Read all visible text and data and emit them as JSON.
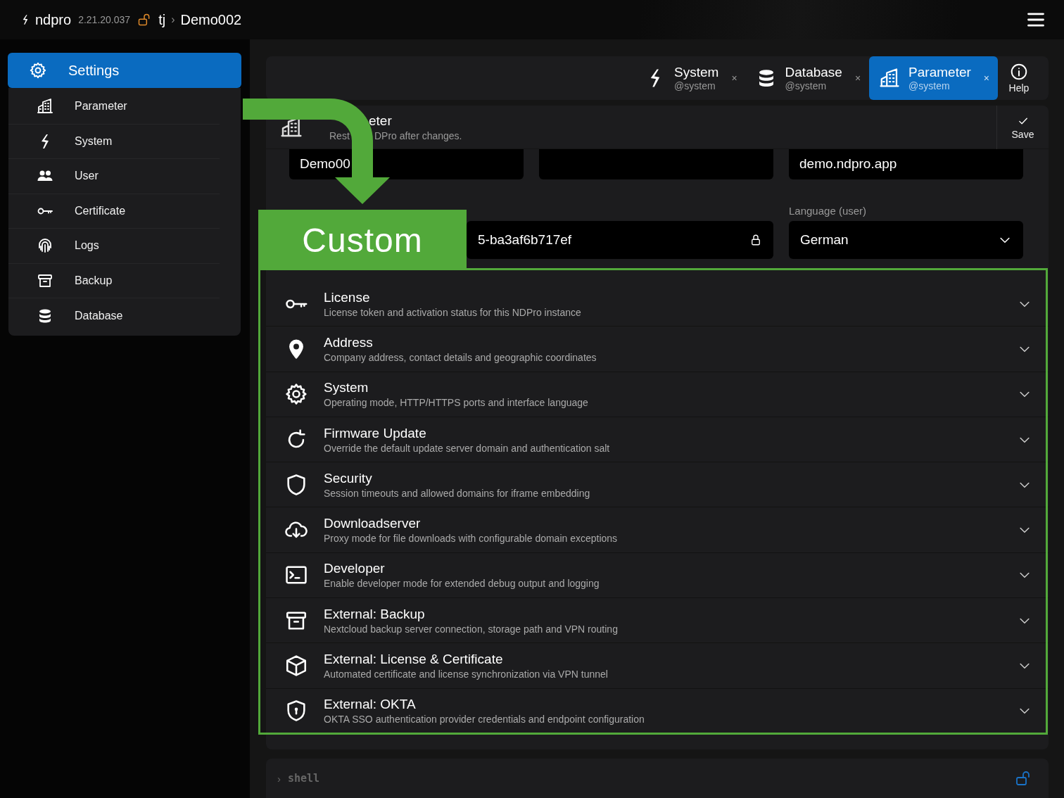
{
  "topbar": {
    "brand": "ndpro",
    "version": "2.21.20.037",
    "user": "tj",
    "separator": "›",
    "instance": "Demo002"
  },
  "sidebar": {
    "header": "Settings",
    "items": [
      {
        "label": "Parameter"
      },
      {
        "label": "System"
      },
      {
        "label": "User"
      },
      {
        "label": "Certificate"
      },
      {
        "label": "Logs"
      },
      {
        "label": "Backup"
      },
      {
        "label": "Database"
      }
    ]
  },
  "tabs": [
    {
      "label": "System",
      "subtitle": "@system",
      "close": "×",
      "selected": false
    },
    {
      "label": "Database",
      "subtitle": "@system",
      "close": "×",
      "selected": false
    },
    {
      "label": "Parameter",
      "subtitle": "@system",
      "close": "×",
      "selected": true
    }
  ],
  "help": "Help",
  "panel": {
    "title": "eter",
    "subtitle_parts": [
      "Rest",
      "DPro after changes."
    ],
    "save": "Save",
    "fields_row_1": [
      {
        "kind": "text",
        "value": "Demo00"
      },
      {
        "kind": "blank"
      },
      {
        "kind": "text",
        "value": "demo.ndpro.app"
      }
    ],
    "system_key": {
      "value": "5-ba3af6b717ef"
    },
    "language": {
      "label": "Language (user)",
      "value": "German"
    },
    "sections": [
      {
        "title": "License",
        "description": "License token and activation status for this NDPro instance"
      },
      {
        "title": "Address",
        "description": "Company address, contact details and geographic coordinates"
      },
      {
        "title": "System",
        "description": "Operating mode, HTTP/HTTPS ports and interface language"
      },
      {
        "title": "Firmware Update",
        "description": "Override the default update server domain and authentication salt"
      },
      {
        "title": "Security",
        "description": "Session timeouts and allowed domains for iframe embedding"
      },
      {
        "title": "Downloadserver",
        "description": "Proxy mode for file downloads with configurable domain exceptions"
      },
      {
        "title": "Developer",
        "description": "Enable developer mode for extended debug output and logging"
      },
      {
        "title": "External: Backup",
        "description": "Nextcloud backup server connection, storage path and VPN routing"
      },
      {
        "title": "External: License & Certificate",
        "description": "Automated certificate and license synchronization via VPN tunnel"
      },
      {
        "title": "External: OKTA",
        "description": "OKTA SSO authentication provider credentials and endpoint configuration"
      }
    ]
  },
  "shell": {
    "prompt": "›",
    "text": "shell"
  },
  "annotation": {
    "label": "Custom"
  }
}
